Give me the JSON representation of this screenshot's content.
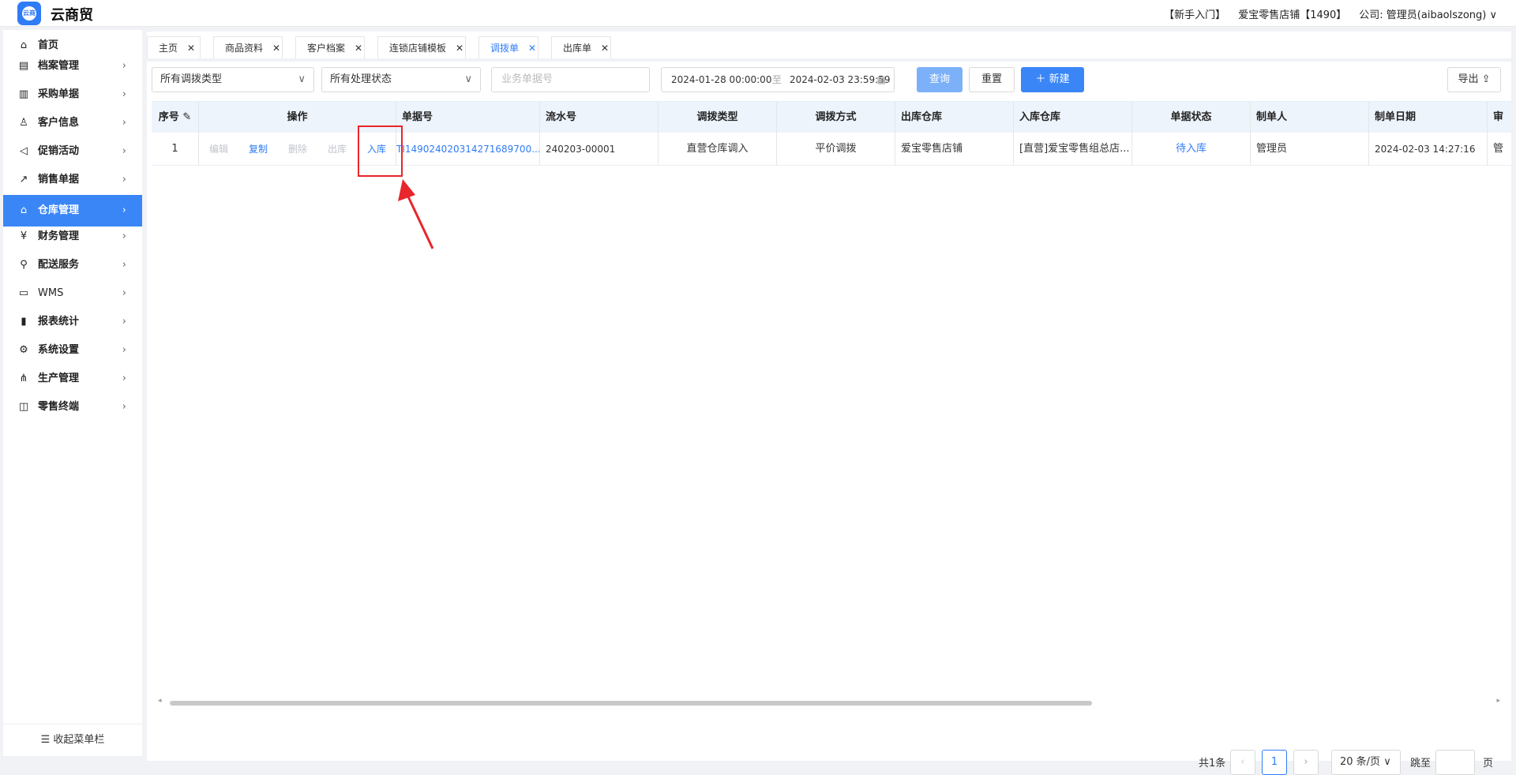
{
  "app": {
    "title": "云商贸",
    "logo_text": "云商"
  },
  "topbar": {
    "guide": "【新手入门】",
    "store": "爱宝零售店铺【1490】",
    "company": "公司: 管理员(aibaolszong)"
  },
  "sidebar": {
    "items": [
      {
        "label": "首页",
        "icon": "home-icon",
        "glyph": "⌂"
      },
      {
        "label": "档案管理",
        "icon": "archive-icon",
        "glyph": "▤"
      },
      {
        "label": "采购单据",
        "icon": "purchase-doc-icon",
        "glyph": "▥"
      },
      {
        "label": "客户信息",
        "icon": "user-icon",
        "glyph": "♙"
      },
      {
        "label": "促销活动",
        "icon": "megaphone-icon",
        "glyph": "◁"
      },
      {
        "label": "销售单据",
        "icon": "chart-line-icon",
        "glyph": "↗"
      },
      {
        "label": "仓库管理",
        "icon": "warehouse-icon",
        "glyph": "⌂"
      },
      {
        "label": "财务管理",
        "icon": "finance-icon",
        "glyph": "¥"
      },
      {
        "label": "配送服务",
        "icon": "cart-icon",
        "glyph": "⚲"
      },
      {
        "label": "WMS",
        "icon": "truck-icon",
        "glyph": "▭"
      },
      {
        "label": "报表统计",
        "icon": "bar-chart-icon",
        "glyph": "▮"
      },
      {
        "label": "系统设置",
        "icon": "gear-icon",
        "glyph": "⚙"
      },
      {
        "label": "生产管理",
        "icon": "network-icon",
        "glyph": "⋔"
      },
      {
        "label": "零售终端",
        "icon": "bag-icon",
        "glyph": "◫"
      }
    ],
    "collapse": "收起菜单栏"
  },
  "tabs": [
    {
      "label": "主页"
    },
    {
      "label": "商品资料"
    },
    {
      "label": "客户档案"
    },
    {
      "label": "连锁店铺模板"
    },
    {
      "label": "调拨单"
    },
    {
      "label": "出库单"
    }
  ],
  "filters": {
    "type_select": "所有调拨类型",
    "status_select": "所有处理状态",
    "doc_placeholder": "业务单据号",
    "date_from": "2024-01-28 00:00:00",
    "date_sep": "至",
    "date_to": "2024-02-03 23:59:59"
  },
  "buttons": {
    "query": "查询",
    "reset": "重置",
    "new": "新建",
    "export": "导出"
  },
  "table": {
    "headers": [
      "序号",
      "操作",
      "单据号",
      "流水号",
      "调拨类型",
      "调拨方式",
      "出库仓库",
      "入库仓库",
      "单据状态",
      "制单人",
      "制单日期",
      "审"
    ],
    "row": {
      "index": "1",
      "ops": [
        "编辑",
        "复制",
        "删除",
        "出库",
        "入库"
      ],
      "doc_no": "TI149024020314271689700...",
      "serial": "240203-00001",
      "type": "直营仓库调入",
      "method": "平价调拨",
      "out_wh": "爱宝零售店铺",
      "in_wh": "[直营]爱宝零售组总店...",
      "status": "待入库",
      "maker": "管理员",
      "date": "2024-02-03 14:27:16",
      "audit": "管"
    }
  },
  "pager": {
    "total": "共1条",
    "page": "1",
    "size": "20 条/页",
    "jump": "跳至",
    "unit": "页"
  },
  "colors": {
    "accent": "#3a86f7",
    "highlight": "#e8262b"
  }
}
